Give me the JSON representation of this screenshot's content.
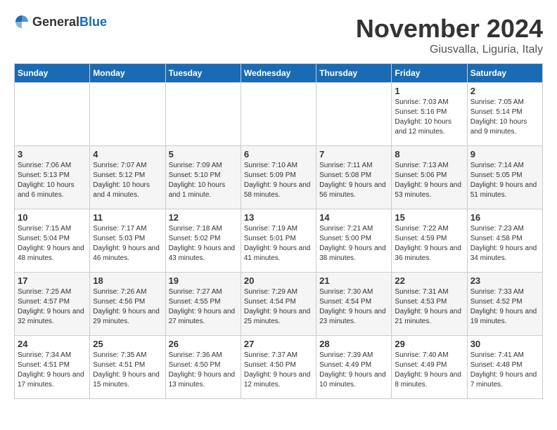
{
  "logo": {
    "general": "General",
    "blue": "Blue"
  },
  "title": "November 2024",
  "location": "Giusvalla, Liguria, Italy",
  "headers": [
    "Sunday",
    "Monday",
    "Tuesday",
    "Wednesday",
    "Thursday",
    "Friday",
    "Saturday"
  ],
  "weeks": [
    [
      {
        "day": "",
        "sunrise": "",
        "sunset": "",
        "daylight": ""
      },
      {
        "day": "",
        "sunrise": "",
        "sunset": "",
        "daylight": ""
      },
      {
        "day": "",
        "sunrise": "",
        "sunset": "",
        "daylight": ""
      },
      {
        "day": "",
        "sunrise": "",
        "sunset": "",
        "daylight": ""
      },
      {
        "day": "",
        "sunrise": "",
        "sunset": "",
        "daylight": ""
      },
      {
        "day": "1",
        "sunrise": "Sunrise: 7:03 AM",
        "sunset": "Sunset: 5:16 PM",
        "daylight": "Daylight: 10 hours and 12 minutes."
      },
      {
        "day": "2",
        "sunrise": "Sunrise: 7:05 AM",
        "sunset": "Sunset: 5:14 PM",
        "daylight": "Daylight: 10 hours and 9 minutes."
      }
    ],
    [
      {
        "day": "3",
        "sunrise": "Sunrise: 7:06 AM",
        "sunset": "Sunset: 5:13 PM",
        "daylight": "Daylight: 10 hours and 6 minutes."
      },
      {
        "day": "4",
        "sunrise": "Sunrise: 7:07 AM",
        "sunset": "Sunset: 5:12 PM",
        "daylight": "Daylight: 10 hours and 4 minutes."
      },
      {
        "day": "5",
        "sunrise": "Sunrise: 7:09 AM",
        "sunset": "Sunset: 5:10 PM",
        "daylight": "Daylight: 10 hours and 1 minute."
      },
      {
        "day": "6",
        "sunrise": "Sunrise: 7:10 AM",
        "sunset": "Sunset: 5:09 PM",
        "daylight": "Daylight: 9 hours and 58 minutes."
      },
      {
        "day": "7",
        "sunrise": "Sunrise: 7:11 AM",
        "sunset": "Sunset: 5:08 PM",
        "daylight": "Daylight: 9 hours and 56 minutes."
      },
      {
        "day": "8",
        "sunrise": "Sunrise: 7:13 AM",
        "sunset": "Sunset: 5:06 PM",
        "daylight": "Daylight: 9 hours and 53 minutes."
      },
      {
        "day": "9",
        "sunrise": "Sunrise: 7:14 AM",
        "sunset": "Sunset: 5:05 PM",
        "daylight": "Daylight: 9 hours and 51 minutes."
      }
    ],
    [
      {
        "day": "10",
        "sunrise": "Sunrise: 7:15 AM",
        "sunset": "Sunset: 5:04 PM",
        "daylight": "Daylight: 9 hours and 48 minutes."
      },
      {
        "day": "11",
        "sunrise": "Sunrise: 7:17 AM",
        "sunset": "Sunset: 5:03 PM",
        "daylight": "Daylight: 9 hours and 46 minutes."
      },
      {
        "day": "12",
        "sunrise": "Sunrise: 7:18 AM",
        "sunset": "Sunset: 5:02 PM",
        "daylight": "Daylight: 9 hours and 43 minutes."
      },
      {
        "day": "13",
        "sunrise": "Sunrise: 7:19 AM",
        "sunset": "Sunset: 5:01 PM",
        "daylight": "Daylight: 9 hours and 41 minutes."
      },
      {
        "day": "14",
        "sunrise": "Sunrise: 7:21 AM",
        "sunset": "Sunset: 5:00 PM",
        "daylight": "Daylight: 9 hours and 38 minutes."
      },
      {
        "day": "15",
        "sunrise": "Sunrise: 7:22 AM",
        "sunset": "Sunset: 4:59 PM",
        "daylight": "Daylight: 9 hours and 36 minutes."
      },
      {
        "day": "16",
        "sunrise": "Sunrise: 7:23 AM",
        "sunset": "Sunset: 4:58 PM",
        "daylight": "Daylight: 9 hours and 34 minutes."
      }
    ],
    [
      {
        "day": "17",
        "sunrise": "Sunrise: 7:25 AM",
        "sunset": "Sunset: 4:57 PM",
        "daylight": "Daylight: 9 hours and 32 minutes."
      },
      {
        "day": "18",
        "sunrise": "Sunrise: 7:26 AM",
        "sunset": "Sunset: 4:56 PM",
        "daylight": "Daylight: 9 hours and 29 minutes."
      },
      {
        "day": "19",
        "sunrise": "Sunrise: 7:27 AM",
        "sunset": "Sunset: 4:55 PM",
        "daylight": "Daylight: 9 hours and 27 minutes."
      },
      {
        "day": "20",
        "sunrise": "Sunrise: 7:29 AM",
        "sunset": "Sunset: 4:54 PM",
        "daylight": "Daylight: 9 hours and 25 minutes."
      },
      {
        "day": "21",
        "sunrise": "Sunrise: 7:30 AM",
        "sunset": "Sunset: 4:54 PM",
        "daylight": "Daylight: 9 hours and 23 minutes."
      },
      {
        "day": "22",
        "sunrise": "Sunrise: 7:31 AM",
        "sunset": "Sunset: 4:53 PM",
        "daylight": "Daylight: 9 hours and 21 minutes."
      },
      {
        "day": "23",
        "sunrise": "Sunrise: 7:33 AM",
        "sunset": "Sunset: 4:52 PM",
        "daylight": "Daylight: 9 hours and 19 minutes."
      }
    ],
    [
      {
        "day": "24",
        "sunrise": "Sunrise: 7:34 AM",
        "sunset": "Sunset: 4:51 PM",
        "daylight": "Daylight: 9 hours and 17 minutes."
      },
      {
        "day": "25",
        "sunrise": "Sunrise: 7:35 AM",
        "sunset": "Sunset: 4:51 PM",
        "daylight": "Daylight: 9 hours and 15 minutes."
      },
      {
        "day": "26",
        "sunrise": "Sunrise: 7:36 AM",
        "sunset": "Sunset: 4:50 PM",
        "daylight": "Daylight: 9 hours and 13 minutes."
      },
      {
        "day": "27",
        "sunrise": "Sunrise: 7:37 AM",
        "sunset": "Sunset: 4:50 PM",
        "daylight": "Daylight: 9 hours and 12 minutes."
      },
      {
        "day": "28",
        "sunrise": "Sunrise: 7:39 AM",
        "sunset": "Sunset: 4:49 PM",
        "daylight": "Daylight: 9 hours and 10 minutes."
      },
      {
        "day": "29",
        "sunrise": "Sunrise: 7:40 AM",
        "sunset": "Sunset: 4:49 PM",
        "daylight": "Daylight: 9 hours and 8 minutes."
      },
      {
        "day": "30",
        "sunrise": "Sunrise: 7:41 AM",
        "sunset": "Sunset: 4:48 PM",
        "daylight": "Daylight: 9 hours and 7 minutes."
      }
    ]
  ]
}
